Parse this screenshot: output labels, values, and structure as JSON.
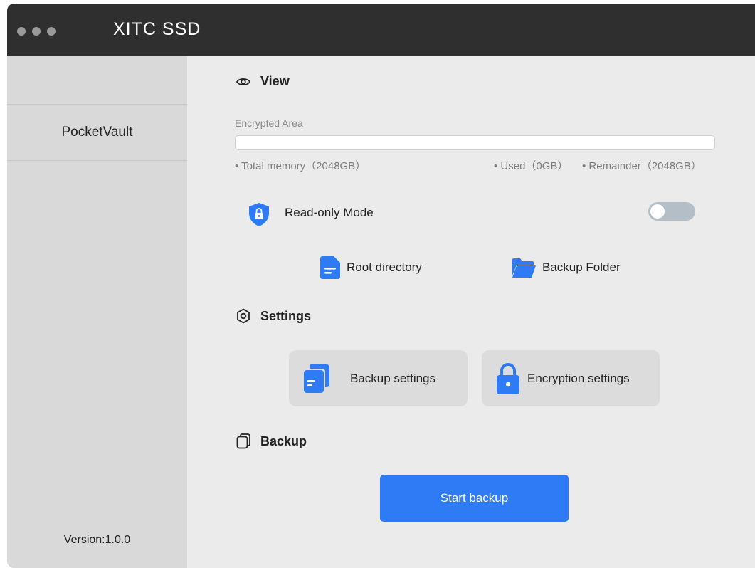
{
  "window": {
    "title": "XITC SSD"
  },
  "sidebar": {
    "items": [
      {
        "label": "PocketVault"
      }
    ],
    "version": "Version:1.0.0"
  },
  "view": {
    "heading": "View",
    "encrypted_area_label": "Encrypted Area",
    "usage_fraction": 0.0,
    "total_memory": "• Total memory（2048GB）",
    "used": "• Used（0GB）",
    "remainder": "• Remainder（2048GB）",
    "read_only_label": "Read-only Mode",
    "read_only_enabled": false,
    "root_directory_label": "Root directory",
    "backup_folder_label": "Backup Folder"
  },
  "settings": {
    "heading": "Settings",
    "backup_settings_label": "Backup settings",
    "encryption_settings_label": "Encryption settings"
  },
  "backup": {
    "heading": "Backup",
    "start_label": "Start backup"
  },
  "colors": {
    "accent": "#2f7bf6",
    "titlebar": "#2f2f2f",
    "sidebar": "#d9d9d9",
    "content": "#ebebeb",
    "toggle_off": "#b3bec7"
  },
  "icons": {
    "view": "eye-icon",
    "settings": "hexagon-gear-icon",
    "backup": "copy-icon",
    "read_only": "shield-lock-icon",
    "root_directory": "file-icon",
    "backup_folder": "folder-open-icon",
    "backup_settings": "copy-file-icon",
    "encryption_settings": "padlock-icon"
  }
}
